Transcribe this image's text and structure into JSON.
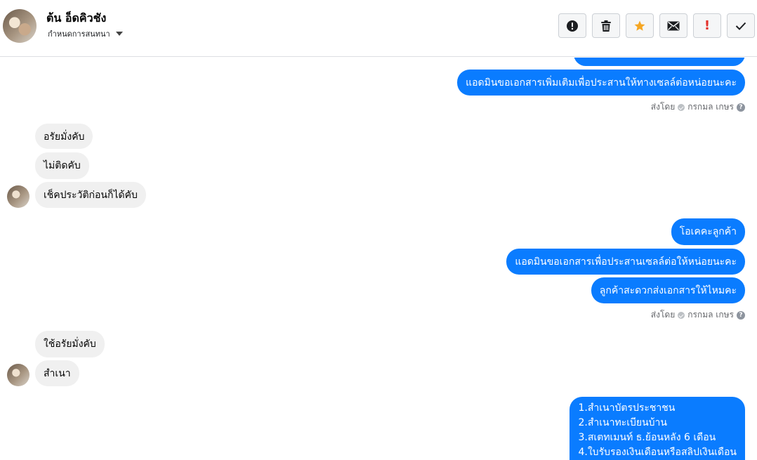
{
  "header": {
    "contact_name": "ต้น อ็ดคิวชัง",
    "subtitle": "กำหนดการสนทนา",
    "toolbar": [
      {
        "name": "report-icon-button",
        "icon": "alert-circle-icon"
      },
      {
        "name": "delete-button",
        "icon": "trash-icon"
      },
      {
        "name": "star-button",
        "icon": "star-icon"
      },
      {
        "name": "mark-unread-button",
        "icon": "envelope-icon"
      },
      {
        "name": "important-button",
        "icon": "exclamation-icon"
      },
      {
        "name": "mark-done-button",
        "icon": "check-icon"
      }
    ],
    "colors": {
      "star": "#f5a623",
      "important": "#e4322b"
    }
  },
  "messages": {
    "m1": "แอดมินขอเอกสารเพิ่มเติมเพื่อประสานให้ทางเซลล์ต่อหน่อยนะคะ",
    "sent_by_1": {
      "label": "ส่งโดย",
      "name": "กรกมล เกษร",
      "help": "?"
    },
    "m2": "อรัยมั่งคับ",
    "m3": "ไม่ติดคับ",
    "m4": "เช็คประวัติก่อนก็ได้คับ",
    "m5": "โอเคคะลูกค้า",
    "m6": "แอดมินขอเอกสารเพื่อประสานเซลล์ต่อให้หน่อยนะคะ",
    "m7": "ลูกค้าสะดวกส่งเอกสารให้ไหมคะ",
    "sent_by_2": {
      "label": "ส่งโดย",
      "name": "กรกมล เกษร",
      "help": "?"
    },
    "m8": "ใช้อรัยมั่งคับ",
    "m9": "สำเนา",
    "m10_lines": [
      "1.สำเนาบัตรประชาชน",
      "2.สำเนาทะเบียนบ้าน",
      "3.สเตทเมนท์ ธ.ย้อนหลัง 6 เดือน",
      "4.ใบรับรองเงินเดือนหรือสลิปเงินเดือน"
    ]
  },
  "colors": {
    "outgoing": "#0a7cff",
    "incoming": "#f0f0f0"
  }
}
